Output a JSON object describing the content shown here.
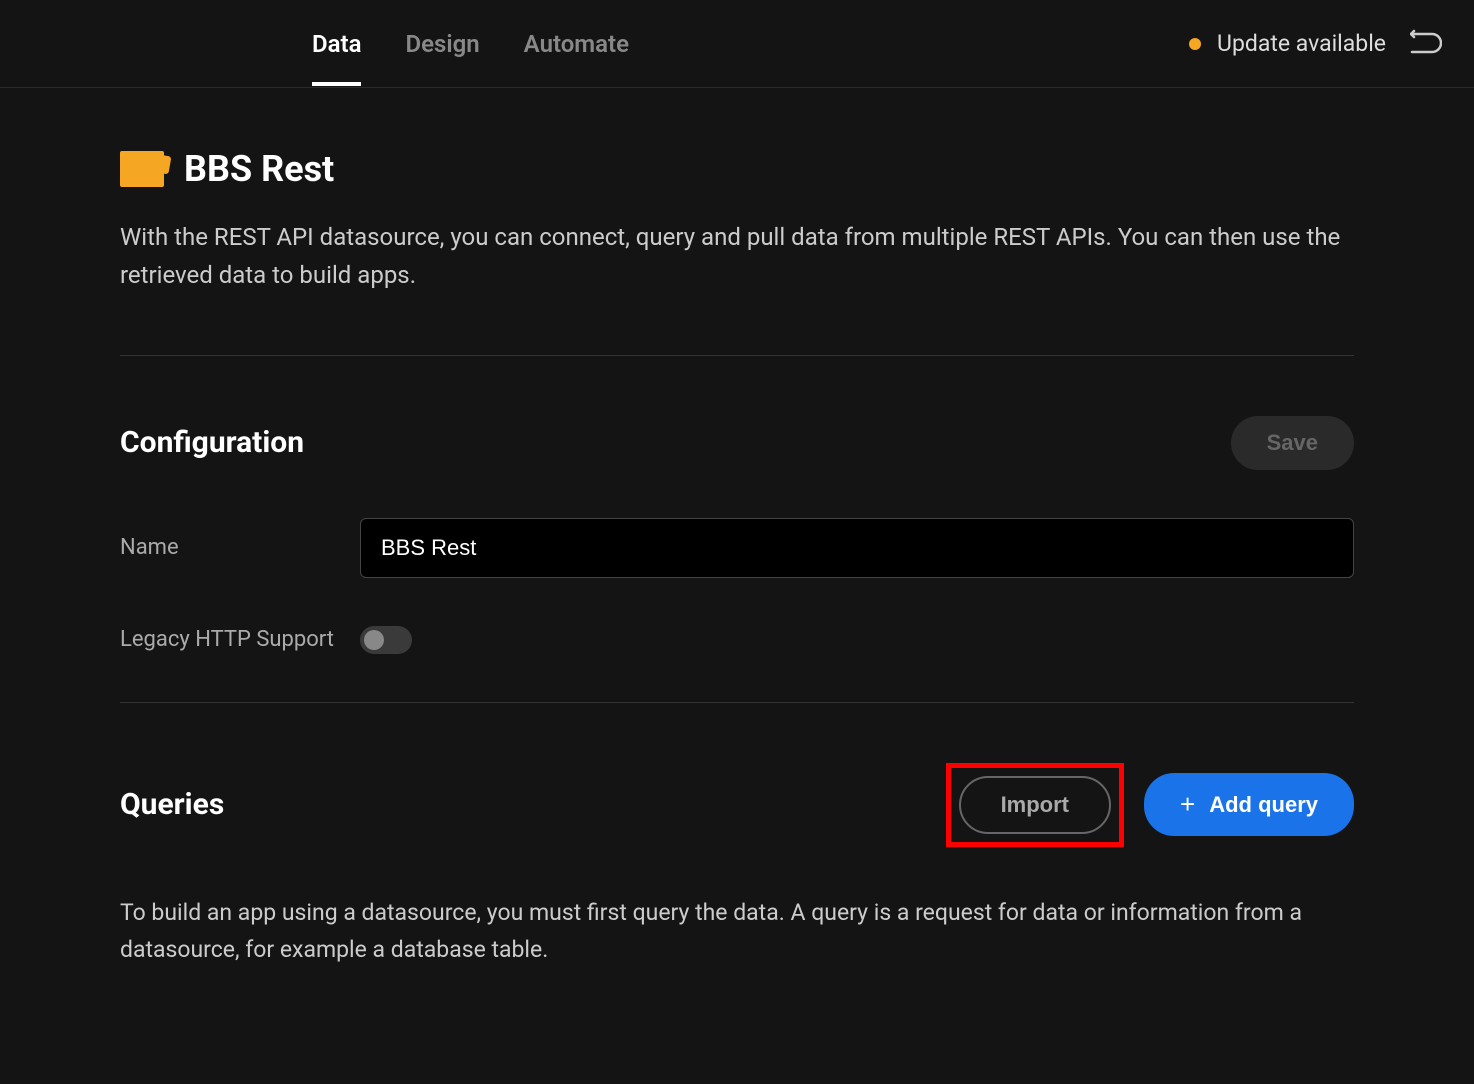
{
  "header": {
    "tabs": [
      {
        "label": "Data",
        "active": true
      },
      {
        "label": "Design",
        "active": false
      },
      {
        "label": "Automate",
        "active": false
      }
    ],
    "update_label": "Update available"
  },
  "page": {
    "title": "BBS Rest",
    "description": "With the REST API datasource, you can connect, query and pull data from multiple REST APIs. You can then use the retrieved data to build apps."
  },
  "configuration": {
    "title": "Configuration",
    "save_label": "Save",
    "fields": {
      "name": {
        "label": "Name",
        "value": "BBS Rest"
      },
      "legacy_http": {
        "label": "Legacy HTTP Support",
        "enabled": false
      }
    }
  },
  "queries": {
    "title": "Queries",
    "import_label": "Import",
    "add_query_label": "Add query",
    "description": "To build an app using a datasource, you must first query the data. A query is a request for data or information from a datasource, for example a database table."
  }
}
